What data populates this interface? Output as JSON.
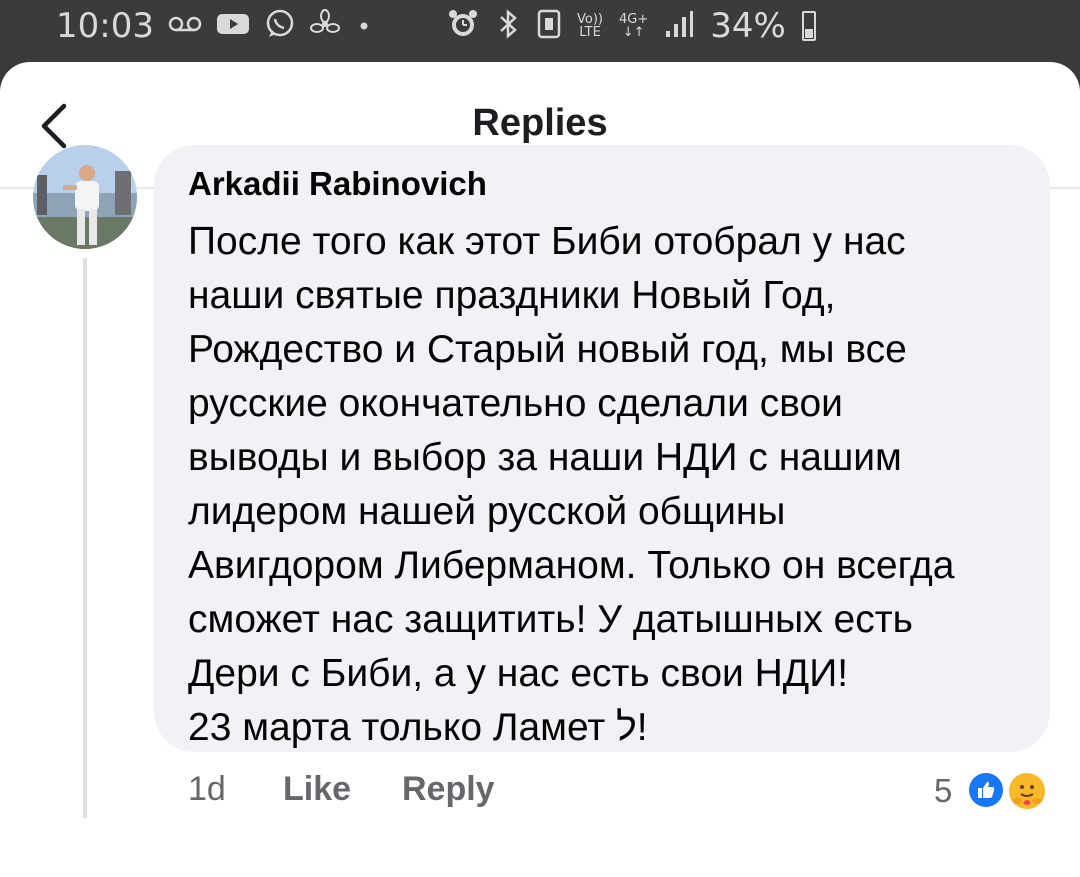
{
  "status_bar": {
    "time": "10:03",
    "voice_label": "Vo))",
    "lte_label": "LTE",
    "network_label": "4G+",
    "battery_percent": "34%",
    "battery_level": 0.34,
    "icons": [
      "voicemail-icon",
      "video-icon",
      "whatsapp-icon",
      "fan-icon",
      "dot-icon",
      "alarm-icon",
      "bluetooth-icon",
      "nfc-icon",
      "signal-icon",
      "battery-icon"
    ]
  },
  "header": {
    "title": "Replies",
    "back_icon": "chevron-left-icon"
  },
  "comment": {
    "author": "Arkadii Rabinovich",
    "lines": [
      "После того как этот Биби отобрал у нас",
      "наши святые праздники Новый Год,",
      "Рождество и Старый новый год, мы все",
      "русские окончательно сделали свои",
      "выводы и выбор за наши НДИ с нашим",
      "лидером нашей русской общины",
      "Авигдором Либерманом. Только он всегда",
      "сможет нас защитить! У датышных есть",
      "Дери с Биби, а у нас есть свои НДИ!",
      "23 марта только Ламет ל!"
    ]
  },
  "actions": {
    "time": "1d",
    "like_label": "Like",
    "reply_label": "Reply",
    "reaction_count": "5",
    "reactions": [
      "like-reaction-icon",
      "care-reaction-icon"
    ]
  },
  "colors": {
    "status_bar_bg": "#3b3b3b",
    "bubble_bg": "#f0f2f5",
    "meta_text": "#65676b",
    "like_blue": "#1877f2"
  }
}
